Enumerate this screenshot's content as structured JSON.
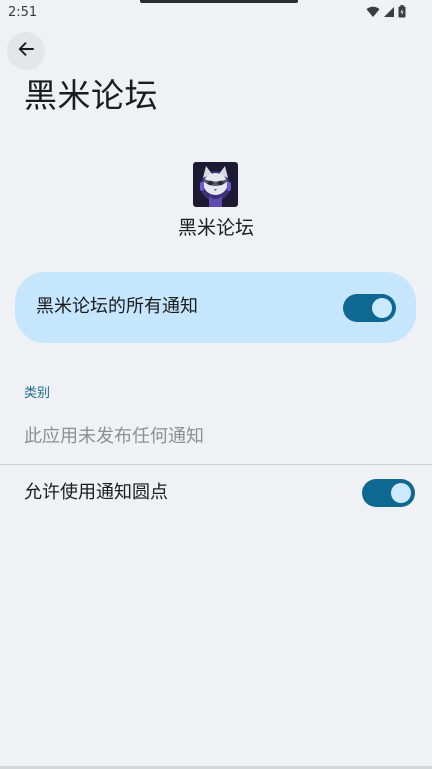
{
  "status_bar": {
    "time": "2:51",
    "icons": [
      "wifi-icon",
      "signal-icon",
      "battery-icon"
    ]
  },
  "header": {
    "back_icon": "arrow-left-icon",
    "title": "黑米论坛"
  },
  "app": {
    "name": "黑米论坛",
    "icon": "cat-avatar-icon"
  },
  "master_toggle": {
    "label": "黑米论坛的所有通知",
    "on": true
  },
  "categories": {
    "header": "类别",
    "empty_text": "此应用未发布任何通知"
  },
  "dot_toggle": {
    "label": "允许使用通知圆点",
    "on": true
  },
  "colors": {
    "background": "#eff1f4",
    "card": "#c5e6fc",
    "switch_track": "#0f6891",
    "switch_thumb": "#cce9ff",
    "accent_text": "#1e6b92"
  }
}
